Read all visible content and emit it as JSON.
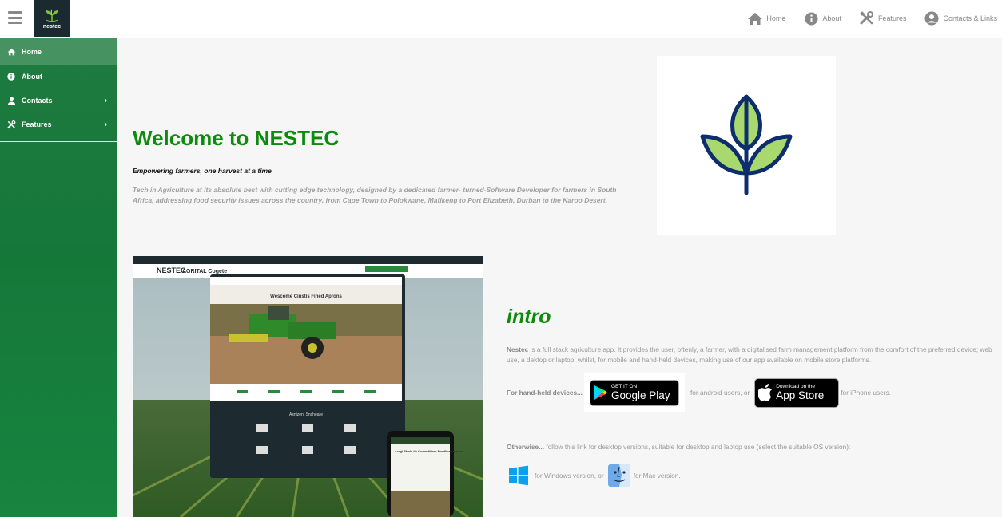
{
  "brand": {
    "logo_text": "nestec"
  },
  "topnav": [
    {
      "label": "Home",
      "icon": "home-icon"
    },
    {
      "label": "About",
      "icon": "info-icon"
    },
    {
      "label": "Features",
      "icon": "tools-icon"
    },
    {
      "label": "Contacts & Links",
      "icon": "user-circle-icon"
    }
  ],
  "sidebar": {
    "items": [
      {
        "label": "Home",
        "icon": "home-icon",
        "active": true
      },
      {
        "label": "About",
        "icon": "info-icon"
      },
      {
        "label": "Contacts",
        "icon": "user-icon",
        "chevron": "›"
      },
      {
        "label": "Features",
        "icon": "tools-icon",
        "chevron": "›"
      }
    ]
  },
  "hero": {
    "title": "Welcome to NESTEC",
    "tagline": "Empowering farmers, one harvest at a time",
    "description": "Tech in Agriculture at its absolute best with cutting edge technology, designed by a dedicated farmer- turned-Software Developer for farmers in South Africa, addressing food security issues across the country, from Cape Town to Polokwane, Mafikeng to Port Elizabeth, Durban to the Karoo Desert."
  },
  "intro": {
    "title": "intro",
    "lead": "Nestec",
    "text": " is a full stack agriculture app. It provides the user, oftenly, a farmer, with a digitalised farm management platform from the comfort of the preferred device; web use, a dektop or laptop, whilst, for mobile and hand-held devices, making use of our app available on mobile store platforms.",
    "handheld_lead": "For hand-held devices...",
    "android_text": "for android users, or",
    "iphone_text": "for iPhone users.",
    "google_play": {
      "small": "GET IT ON",
      "big": "Google Play"
    },
    "app_store": {
      "small": "Download on the",
      "big": "App Store"
    },
    "otherwise_lead": "Otherwise...",
    "otherwise_text": " follow this link for desktop versions, suitable for desktop and laptop use (select the suitable OS version):",
    "windows_text": "for Windows version, or",
    "mac_text": "for Mac version."
  },
  "mockup": {
    "brand": "NESTEC",
    "brand_sub": "AGRITAL Cogete",
    "headline": "Wescome Cinstis Fined Aprons",
    "section": "Asnizent Snsheare",
    "phone_text": "Acrgi Stmle tie Comertitlem Pwntlinnaluwere"
  },
  "colors": {
    "brand_green": "#0e8a0e",
    "sidebar_green": "#1a7e3e",
    "plant_navy": "#0d2d6c",
    "plant_leaf": "#a8d86e"
  }
}
